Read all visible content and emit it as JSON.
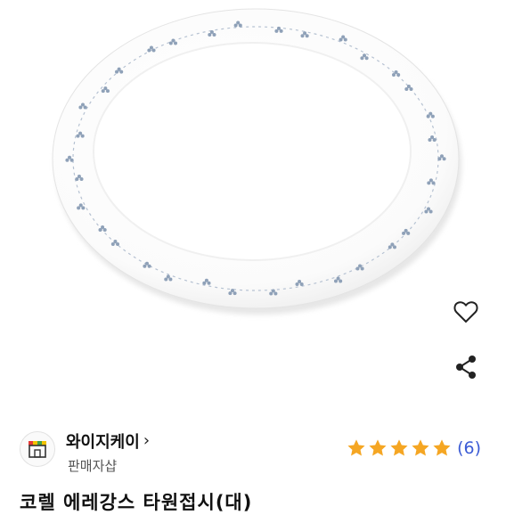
{
  "product": {
    "image_alt": "oval white plate with blue floral border",
    "title": "코렐 에레강스 타원접시(대)"
  },
  "actions": {
    "like_icon": "heart-outline-icon",
    "share_icon": "share-icon"
  },
  "seller": {
    "name": "와이지케이",
    "chevron": "›",
    "type": "판매자샵",
    "logo_icon": "shop-icon"
  },
  "rating": {
    "stars": 5,
    "max_stars": 5,
    "review_count_text": "(6)",
    "star_color": "#f5a623"
  },
  "colors": {
    "review_count": "#3b5bd5",
    "plate_border_flowers": "#8fa1b8"
  }
}
